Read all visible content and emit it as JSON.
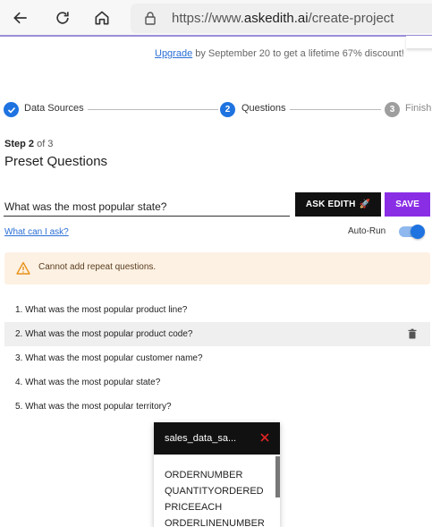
{
  "browser": {
    "url_prefix": "https://www.",
    "url_domain": "askedith.ai",
    "url_path": "/create-project"
  },
  "promo": {
    "link": "Upgrade",
    "text": " by September 20 to get a lifetime 67% discount!"
  },
  "stepper": {
    "steps": [
      {
        "label": "Data Sources",
        "state": "complete"
      },
      {
        "number": "2",
        "label": "Questions",
        "state": "active"
      },
      {
        "number": "3",
        "label": "Finish",
        "state": "pending"
      }
    ]
  },
  "step_counter": {
    "prefix": "Step 2",
    "suffix": " of 3"
  },
  "page_title": "Preset Questions",
  "question_input": {
    "value": "What was the most popular state?"
  },
  "buttons": {
    "ask": "ASK EDITH",
    "ask_emoji": "🚀",
    "save": "SAVE"
  },
  "help_link": "What can I ask?",
  "autorun": {
    "label": "Auto-Run",
    "enabled": true
  },
  "warning": {
    "text": "Cannot add repeat questions."
  },
  "questions": [
    "1. What was the most popular product line?",
    "2. What was the most popular product code?",
    "3. What was the most popular customer name?",
    "4. What was the most popular state?",
    "5. What was the most popular territory?"
  ],
  "dropdown": {
    "title": "sales_data_sa...",
    "items": [
      "ORDERNUMBER",
      "QUANTITYORDERED",
      "PRICEEACH",
      "ORDERLINENUMBER"
    ]
  },
  "colors": {
    "accent_blue": "#1e73e0",
    "save_purple": "#8a2ee6",
    "warning_bg": "#fdf1e3",
    "close_red": "#e02424"
  }
}
